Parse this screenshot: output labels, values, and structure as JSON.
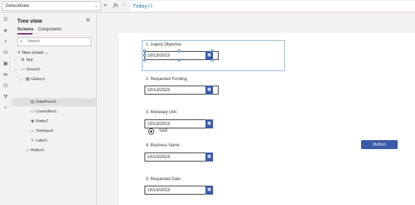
{
  "formula_bar": {
    "property": "DefaultDate",
    "fx_label": "fx",
    "formula": "Today()"
  },
  "tree_view": {
    "title": "Tree view",
    "tabs": [
      "Screens",
      "Components"
    ],
    "search_placeholder": "Search",
    "new_screen_label": "New screen",
    "nodes": [
      {
        "label": "App"
      },
      {
        "label": "Screen1"
      },
      {
        "label": "Gallery1"
      },
      {
        "label": "DatePicker1"
      },
      {
        "label": "ComboBox1"
      },
      {
        "label": "Radio2"
      },
      {
        "label": "TextInput1"
      },
      {
        "label": "Label1"
      },
      {
        "label": "Button1"
      }
    ]
  },
  "canvas": {
    "fields": [
      {
        "label": "1. Inquiry Objective",
        "value": "10/13/2023"
      },
      {
        "label": "2. Requested Funding",
        "value": "10/13/2023"
      },
      {
        "label": "3. Monetary Unit",
        "value": "10/13/2023"
      },
      {
        "label": "4. Business Name",
        "value": "10/13/2023"
      },
      {
        "label": "5. Requested Date",
        "value": "10/13/2023"
      }
    ],
    "radio_option": "SAR",
    "button_label": "Button"
  },
  "colors": {
    "accent": "#742774",
    "button": "#3a5ba8",
    "selection": "#8ab4d4"
  }
}
